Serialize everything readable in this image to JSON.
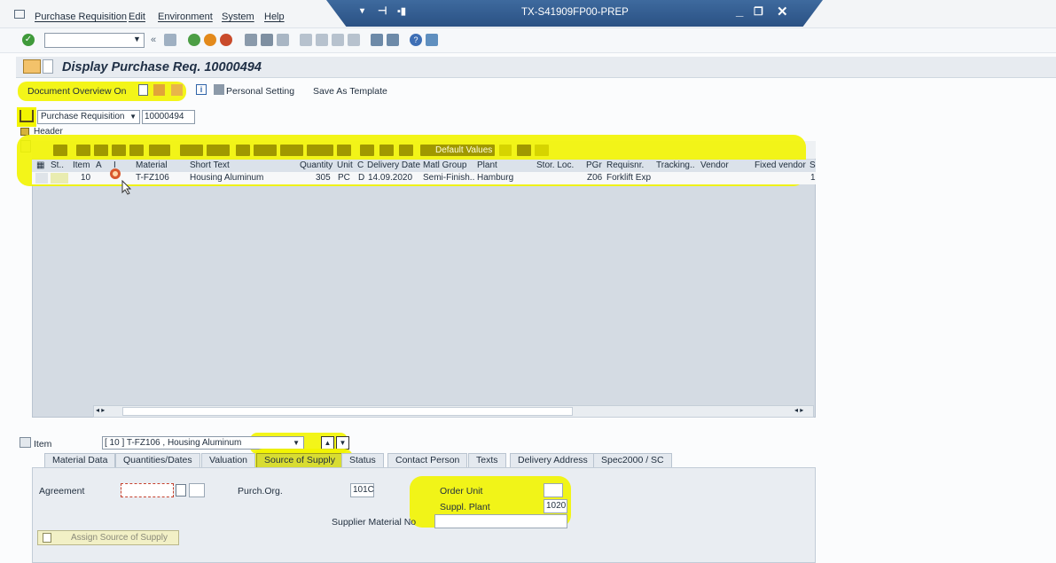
{
  "menu": [
    "Purchase Requisition",
    "Edit",
    "Environment",
    "System",
    "Help"
  ],
  "window": {
    "title": "TX-S41909FP00-PREP"
  },
  "screen": {
    "title": "Display Purchase Req. 10000494"
  },
  "app_toolbar": {
    "doc_overview": "Document Overview On",
    "personal_setting": "Personal Setting",
    "save_template": "Save As Template"
  },
  "header": {
    "doc_type": "Purchase Requisition",
    "doc_number": "10000494",
    "header_label": "Header"
  },
  "grid": {
    "default_values": "Default Values",
    "columns": [
      "St..",
      "Item",
      "A",
      "I",
      "Material",
      "Short Text",
      "Quantity",
      "Unit",
      "C",
      "Delivery Date",
      "Matl Group",
      "Plant",
      "Stor. Loc.",
      "PGr",
      "Requisnr.",
      "Tracking..",
      "Vendor",
      "Fixed vendor",
      "S"
    ],
    "row": {
      "item": "10",
      "material": "T-FZ106",
      "short_text": "Housing Aluminum",
      "quantity": "305",
      "unit": "PC",
      "c": "D",
      "delivery_date": "14.09.2020",
      "matl_group": "Semi-Finish..",
      "plant": "Hamburg",
      "pgr": "Z06",
      "requisnr": "Forklift Exp",
      "s": "1"
    }
  },
  "item_detail": {
    "label": "Item",
    "selected": "[ 10 ] T-FZ106 , Housing Aluminum",
    "tabs": [
      "Material Data",
      "Quantities/Dates",
      "Valuation",
      "Source of Supply",
      "Status",
      "Contact Person",
      "Texts",
      "Delivery Address",
      "Spec2000 / SC"
    ],
    "fields": {
      "agreement_label": "Agreement",
      "purch_org_label": "Purch.Org.",
      "purch_org_value": "101C",
      "order_unit_label": "Order Unit",
      "suppl_plant_label": "Suppl. Plant",
      "suppl_plant_value": "1020",
      "supplier_material_label": "Supplier Material No",
      "assign_button": "Assign Source of Supply"
    }
  },
  "colors": {
    "highlight": "#f2f400",
    "title_blue": "#2a5184"
  }
}
